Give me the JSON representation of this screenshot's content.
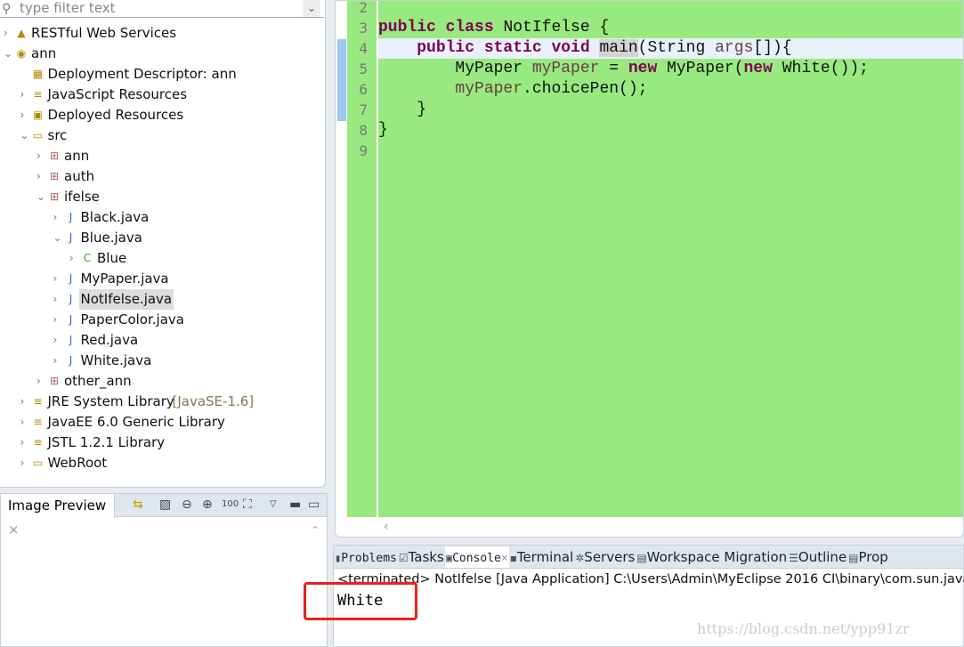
{
  "explorer": {
    "filter_placeholder": "type filter text",
    "rows": [
      {
        "label": "RESTful Web Services",
        "level": 0,
        "arrow": "›",
        "icon": "▲",
        "icon_name": "rest-services-icon"
      },
      {
        "label": "ann",
        "level": 0,
        "arrow": "⌄",
        "icon": "◉",
        "icon_name": "web-project-icon"
      },
      {
        "label": "Deployment Descriptor: ann",
        "level": 1,
        "arrow": "",
        "icon": "▦",
        "icon_name": "deployment-descriptor-icon"
      },
      {
        "label": "JavaScript Resources",
        "level": 1,
        "arrow": "›",
        "icon": "≡",
        "icon_name": "javascript-resources-icon"
      },
      {
        "label": "Deployed Resources",
        "level": 1,
        "arrow": "›",
        "icon": "▣",
        "icon_name": "deployed-resources-icon"
      },
      {
        "label": "src",
        "level": 1,
        "arrow": "⌄",
        "icon": "▭",
        "icon_name": "source-folder-icon"
      },
      {
        "label": "ann",
        "level": 2,
        "arrow": "›",
        "icon": "⊞",
        "icon_name": "package-icon"
      },
      {
        "label": "auth",
        "level": 2,
        "arrow": "›",
        "icon": "⊞",
        "icon_name": "package-icon"
      },
      {
        "label": "ifelse",
        "level": 2,
        "arrow": "⌄",
        "icon": "⊞",
        "icon_name": "package-icon"
      },
      {
        "label": "Black.java",
        "level": 3,
        "arrow": "›",
        "icon": "J",
        "icon_name": "java-file-icon"
      },
      {
        "label": "Blue.java",
        "level": 3,
        "arrow": "⌄",
        "icon": "J",
        "icon_name": "java-file-icon"
      },
      {
        "label": "Blue",
        "level": 4,
        "arrow": "›",
        "icon": "C",
        "icon_name": "class-icon"
      },
      {
        "label": "MyPaper.java",
        "level": 3,
        "arrow": "›",
        "icon": "J",
        "icon_name": "java-file-icon"
      },
      {
        "label": "NotIfelse.java",
        "level": 3,
        "arrow": "›",
        "icon": "J",
        "icon_name": "java-file-icon",
        "selected": true
      },
      {
        "label": "PaperColor.java",
        "level": 3,
        "arrow": "›",
        "icon": "J",
        "icon_name": "java-file-icon"
      },
      {
        "label": "Red.java",
        "level": 3,
        "arrow": "›",
        "icon": "J",
        "icon_name": "java-file-icon"
      },
      {
        "label": "White.java",
        "level": 3,
        "arrow": "›",
        "icon": "J",
        "icon_name": "java-file-icon"
      },
      {
        "label": "other_ann",
        "level": 2,
        "arrow": "›",
        "icon": "⊞",
        "icon_name": "package-icon"
      },
      {
        "label": "JRE System Library",
        "level": 1,
        "arrow": "›",
        "icon": "≡",
        "icon_name": "library-icon",
        "decoration": "[JavaSE-1.6]"
      },
      {
        "label": "JavaEE 6.0 Generic Library",
        "level": 1,
        "arrow": "›",
        "icon": "≡",
        "icon_name": "library-icon"
      },
      {
        "label": "JSTL 1.2.1 Library",
        "level": 1,
        "arrow": "›",
        "icon": "≡",
        "icon_name": "library-icon"
      },
      {
        "label": "WebRoot",
        "level": 1,
        "arrow": "›",
        "icon": "▭",
        "icon_name": "folder-icon"
      }
    ]
  },
  "image_preview": {
    "tab_label": "Image Preview"
  },
  "editor": {
    "lines": [
      {
        "n": "2",
        "tokens": []
      },
      {
        "n": "3",
        "tokens": [
          [
            "public class ",
            "kw"
          ],
          [
            "NotIfelse {",
            ""
          ]
        ]
      },
      {
        "n": "4",
        "current": true,
        "tokens": [
          [
            "    ",
            ""
          ],
          [
            "public static void ",
            "kw"
          ],
          [
            "main",
            "hl"
          ],
          [
            "(String ",
            ""
          ],
          [
            "args",
            "lv"
          ],
          [
            "[]){",
            ""
          ]
        ]
      },
      {
        "n": "5",
        "tokens": [
          [
            "        MyPaper ",
            ""
          ],
          [
            "myPaper",
            "lv"
          ],
          [
            " = ",
            ""
          ],
          [
            "new ",
            "kw"
          ],
          [
            "MyPaper(",
            ""
          ],
          [
            "new ",
            "kw"
          ],
          [
            "White());",
            ""
          ]
        ]
      },
      {
        "n": "6",
        "tokens": [
          [
            "        ",
            ""
          ],
          [
            "myPaper",
            "lv"
          ],
          [
            ".choicePen();",
            ""
          ]
        ]
      },
      {
        "n": "7",
        "tokens": [
          [
            "    }",
            ""
          ]
        ]
      },
      {
        "n": "8",
        "tokens": [
          [
            "}",
            ""
          ]
        ]
      },
      {
        "n": "9",
        "tokens": []
      }
    ]
  },
  "bottom": {
    "tabs": [
      {
        "label": "Problems",
        "icon": "▮",
        "mono": true
      },
      {
        "label": "Tasks",
        "icon": "☑"
      },
      {
        "label": "Console",
        "icon": "▣",
        "mono": true,
        "active": true
      },
      {
        "label": "Terminal",
        "icon": "▪"
      },
      {
        "label": "Servers",
        "icon": "✲"
      },
      {
        "label": "Workspace Migration",
        "icon": "▤"
      },
      {
        "label": "Outline",
        "icon": "☰"
      },
      {
        "label": "Prop",
        "icon": "▤"
      }
    ],
    "terminated": "<terminated> NotIfelse [Java Application] C:\\Users\\Admin\\MyEclipse 2016 CI\\binary\\com.sun.java",
    "output": "White"
  },
  "watermark": "https://blog.csdn.net/ypp91zr",
  "colors": {
    "editor_bg": "#98ea80",
    "keyword": "#7f0055",
    "local_var": "#6a3e3e",
    "highlight_box": "#f0201a"
  }
}
